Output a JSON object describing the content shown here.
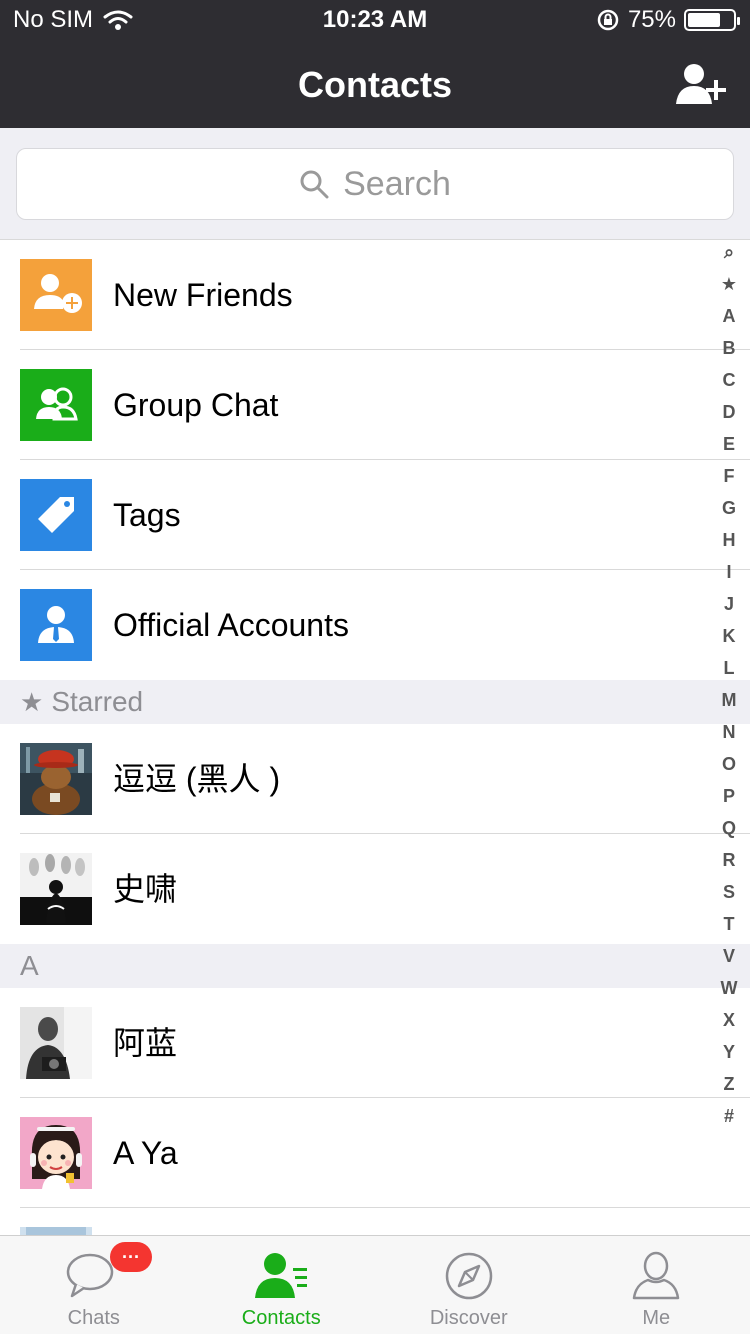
{
  "status_bar": {
    "carrier": "No SIM",
    "time": "10:23 AM",
    "battery_percent": "75%",
    "battery_level": 0.75,
    "icons": [
      "wifi-icon",
      "orientation-lock-icon",
      "battery-icon"
    ]
  },
  "nav": {
    "title": "Contacts",
    "add_icon": "add-contact-icon"
  },
  "search": {
    "placeholder": "Search",
    "icon": "search-icon"
  },
  "actions": [
    {
      "label": "New Friends",
      "icon": "new-friends-icon",
      "color": "#f4a13b"
    },
    {
      "label": "Group Chat",
      "icon": "group-chat-icon",
      "color": "#1aad19"
    },
    {
      "label": "Tags",
      "icon": "tag-icon",
      "color": "#2b87e3"
    },
    {
      "label": "Official Accounts",
      "icon": "official-accounts-icon",
      "color": "#2b87e3"
    }
  ],
  "sections": {
    "starred": {
      "title": "Starred",
      "icon": "star-icon"
    },
    "a": {
      "title": "A"
    }
  },
  "contacts": {
    "starred": [
      {
        "name": "逗逗 (黑人 )"
      },
      {
        "name": "史啸"
      }
    ],
    "a": [
      {
        "name": "阿蓝"
      },
      {
        "name": "A Ya"
      }
    ]
  },
  "index_letters": [
    "⌕",
    "★",
    "A",
    "B",
    "C",
    "D",
    "E",
    "F",
    "G",
    "H",
    "I",
    "J",
    "K",
    "L",
    "M",
    "N",
    "O",
    "P",
    "Q",
    "R",
    "S",
    "T",
    "V",
    "W",
    "X",
    "Y",
    "Z",
    "#"
  ],
  "tabs": [
    {
      "label": "Chats",
      "icon": "chats-icon",
      "badge": "···"
    },
    {
      "label": "Contacts",
      "icon": "contacts-icon",
      "active": true
    },
    {
      "label": "Discover",
      "icon": "compass-icon"
    },
    {
      "label": "Me",
      "icon": "person-icon"
    }
  ],
  "colors": {
    "accent": "#1aad19",
    "header": "#2e2d32",
    "badge": "#f43530"
  }
}
